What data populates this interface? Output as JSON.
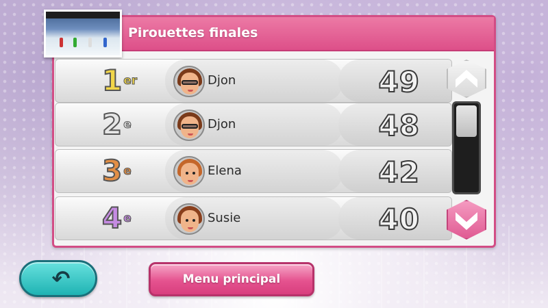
{
  "header": {
    "title": "Pirouettes finales"
  },
  "rows": [
    {
      "rank": "1",
      "suffix": "er",
      "name": "Djon",
      "score": "49",
      "rank_color": "#f1d64a",
      "avatar": "djon"
    },
    {
      "rank": "2",
      "suffix": "e",
      "name": "Djon",
      "score": "48",
      "rank_color": "#e6e6e6",
      "avatar": "djon"
    },
    {
      "rank": "3",
      "suffix": "e",
      "name": "Elena",
      "score": "42",
      "rank_color": "#e28e45",
      "avatar": "elena"
    },
    {
      "rank": "4",
      "suffix": "e",
      "name": "Susie",
      "score": "40",
      "rank_color": "#c58be2",
      "avatar": "susie"
    }
  ],
  "scroll": {
    "position": 0.0
  },
  "buttons": {
    "back_icon": "back-arrow-icon",
    "menu_label": "Menu principal"
  },
  "colors": {
    "accent": "#dd4f89",
    "back": "#1fb3b3"
  }
}
